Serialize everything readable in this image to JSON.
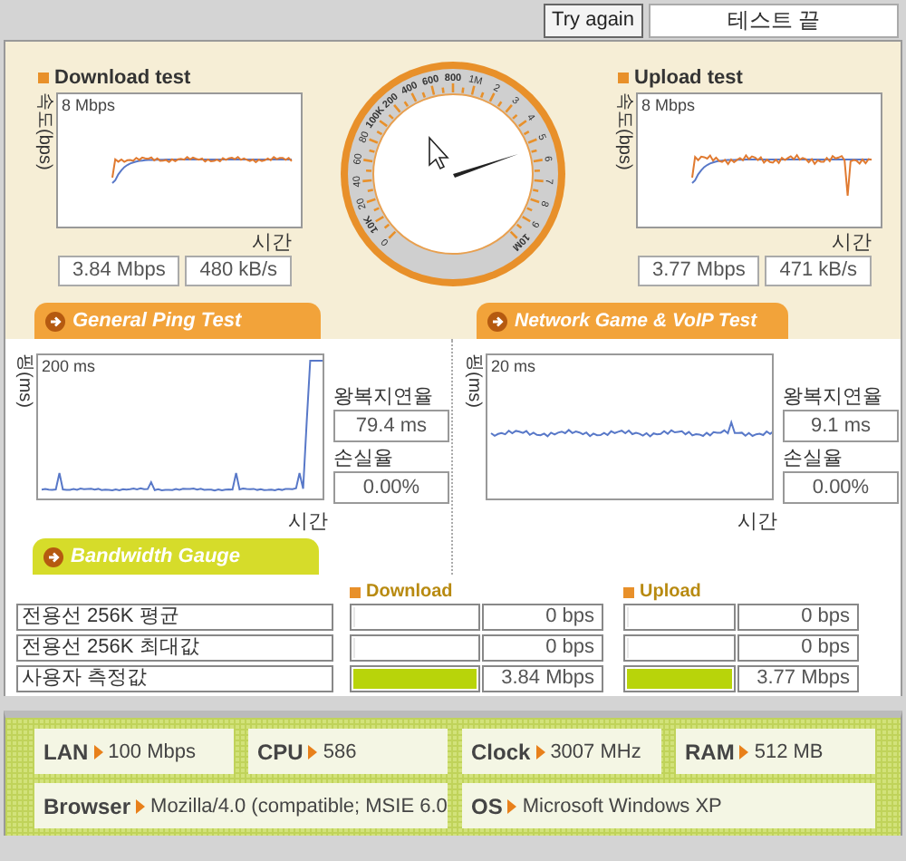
{
  "toolbar": {
    "retry_button": "Try again",
    "status_field": "테스트 끝"
  },
  "throughput": [
    {
      "title": "Download test",
      "y_label": "속도(bps)",
      "scale_label": "8 Mbps",
      "x_label": "시간",
      "rate": "3.84 Mbps",
      "bytes": "480 kB/s"
    },
    {
      "title": "Upload test",
      "y_label": "속도(bps)",
      "scale_label": "8 Mbps",
      "x_label": "시간",
      "rate": "3.77 Mbps",
      "bytes": "471 kB/s"
    }
  ],
  "gauge": {
    "labels": [
      "0",
      "10K",
      "20",
      "40",
      "60",
      "80",
      "100K",
      "200",
      "400",
      "600",
      "800",
      "1M",
      "2",
      "3",
      "4",
      "5",
      "6",
      "7",
      "8",
      "9",
      "10M"
    ]
  },
  "ping_tests": [
    {
      "tab": "General Ping Test",
      "y_label": "핑(ms)",
      "scale_label": "200 ms",
      "x_label": "시간",
      "latency_label": "왕복지연율",
      "latency": "79.4 ms",
      "loss_label": "손실율",
      "loss": "0.00%"
    },
    {
      "tab": "Network Game & VoIP Test",
      "y_label": "핑(ms)",
      "scale_label": "20 ms",
      "x_label": "시간",
      "latency_label": "왕복지연율",
      "latency": "9.1 ms",
      "loss_label": "손실율",
      "loss": "0.00%"
    }
  ],
  "bandwidth": {
    "tab": "Bandwidth Gauge",
    "columns": [
      "Download",
      "Upload"
    ],
    "rows": [
      {
        "label": "전용선 256K 평균",
        "download": {
          "level": 0,
          "value": "0 bps"
        },
        "upload": {
          "level": 0,
          "value": "0 bps"
        }
      },
      {
        "label": "전용선 256K 최대값",
        "download": {
          "level": 0,
          "value": "0 bps"
        },
        "upload": {
          "level": 0,
          "value": "0 bps"
        }
      },
      {
        "label": "사용자 측정값",
        "download": {
          "level": 1,
          "value": "3.84 Mbps"
        },
        "upload": {
          "level": 1,
          "value": "3.77 Mbps"
        }
      }
    ]
  },
  "system_info": [
    {
      "label": "LAN",
      "value": "100 Mbps"
    },
    {
      "label": "CPU",
      "value": "586"
    },
    {
      "label": "Clock",
      "value": "3007 MHz"
    },
    {
      "label": "RAM",
      "value": "512 MB"
    },
    {
      "label": "Browser",
      "value": "Mozilla/4.0 (compatible; MSIE 6.0"
    },
    {
      "label": "OS",
      "value": "Microsoft Windows XP"
    }
  ]
}
